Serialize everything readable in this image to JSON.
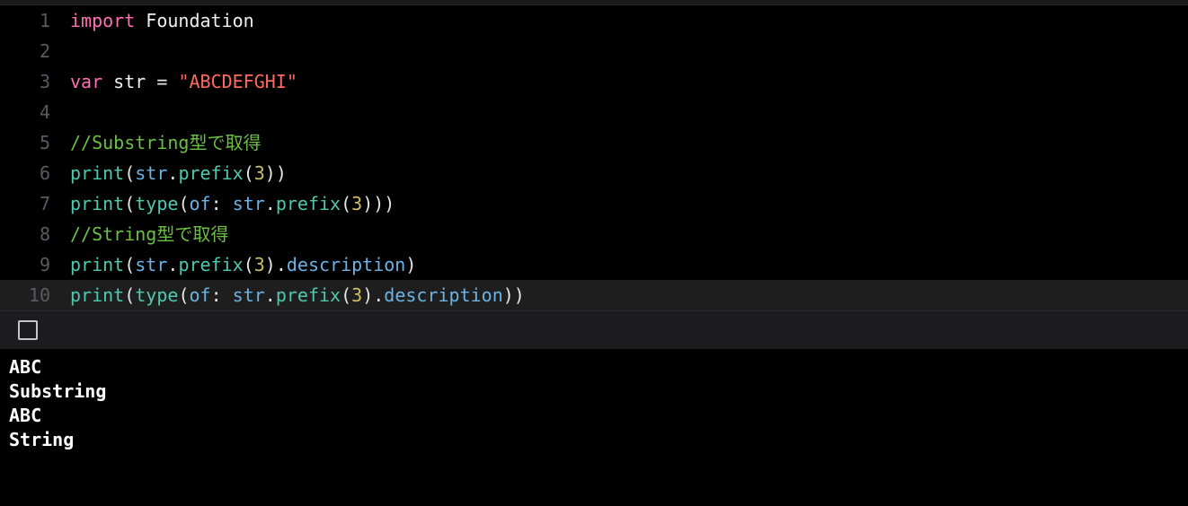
{
  "editor": {
    "lines": [
      {
        "num": "1",
        "hl": false,
        "tokens": [
          [
            "keyword",
            "import"
          ],
          [
            "ident",
            " Foundation"
          ]
        ]
      },
      {
        "num": "2",
        "hl": false,
        "tokens": []
      },
      {
        "num": "3",
        "hl": false,
        "tokens": [
          [
            "keyword",
            "var"
          ],
          [
            "ident",
            " str "
          ],
          [
            "op",
            "= "
          ],
          [
            "string",
            "\"ABCDEFGHI\""
          ]
        ]
      },
      {
        "num": "4",
        "hl": false,
        "tokens": []
      },
      {
        "num": "5",
        "hl": false,
        "tokens": [
          [
            "comment",
            "//Substring型で取得"
          ]
        ]
      },
      {
        "num": "6",
        "hl": false,
        "tokens": [
          [
            "func",
            "print"
          ],
          [
            "paren",
            "("
          ],
          [
            "blue",
            "str"
          ],
          [
            "op",
            "."
          ],
          [
            "func",
            "prefix"
          ],
          [
            "paren",
            "("
          ],
          [
            "num",
            "3"
          ],
          [
            "paren",
            ")"
          ],
          [
            "paren",
            ")"
          ]
        ]
      },
      {
        "num": "7",
        "hl": false,
        "tokens": [
          [
            "func",
            "print"
          ],
          [
            "paren",
            "("
          ],
          [
            "func",
            "type"
          ],
          [
            "paren",
            "("
          ],
          [
            "label",
            "of"
          ],
          [
            "op",
            ": "
          ],
          [
            "blue",
            "str"
          ],
          [
            "op",
            "."
          ],
          [
            "func",
            "prefix"
          ],
          [
            "paren",
            "("
          ],
          [
            "num",
            "3"
          ],
          [
            "paren",
            ")"
          ],
          [
            "paren",
            ")"
          ],
          [
            "paren",
            ")"
          ]
        ]
      },
      {
        "num": "8",
        "hl": false,
        "tokens": [
          [
            "comment",
            "//String型で取得"
          ]
        ]
      },
      {
        "num": "9",
        "hl": false,
        "tokens": [
          [
            "func",
            "print"
          ],
          [
            "paren",
            "("
          ],
          [
            "blue",
            "str"
          ],
          [
            "op",
            "."
          ],
          [
            "func",
            "prefix"
          ],
          [
            "paren",
            "("
          ],
          [
            "num",
            "3"
          ],
          [
            "paren",
            ")"
          ],
          [
            "op",
            "."
          ],
          [
            "prop",
            "description"
          ],
          [
            "paren",
            ")"
          ]
        ]
      },
      {
        "num": "10",
        "hl": true,
        "tokens": [
          [
            "func",
            "print"
          ],
          [
            "paren",
            "("
          ],
          [
            "func",
            "type"
          ],
          [
            "paren",
            "("
          ],
          [
            "label",
            "of"
          ],
          [
            "op",
            ": "
          ],
          [
            "blue",
            "str"
          ],
          [
            "op",
            "."
          ],
          [
            "func",
            "prefix"
          ],
          [
            "paren",
            "("
          ],
          [
            "num",
            "3"
          ],
          [
            "paren",
            ")"
          ],
          [
            "op",
            "."
          ],
          [
            "prop",
            "description"
          ],
          [
            "paren",
            ")"
          ],
          [
            "paren",
            ")"
          ]
        ]
      }
    ]
  },
  "console": {
    "output": [
      "ABC",
      "Substring",
      "ABC",
      "String"
    ]
  }
}
